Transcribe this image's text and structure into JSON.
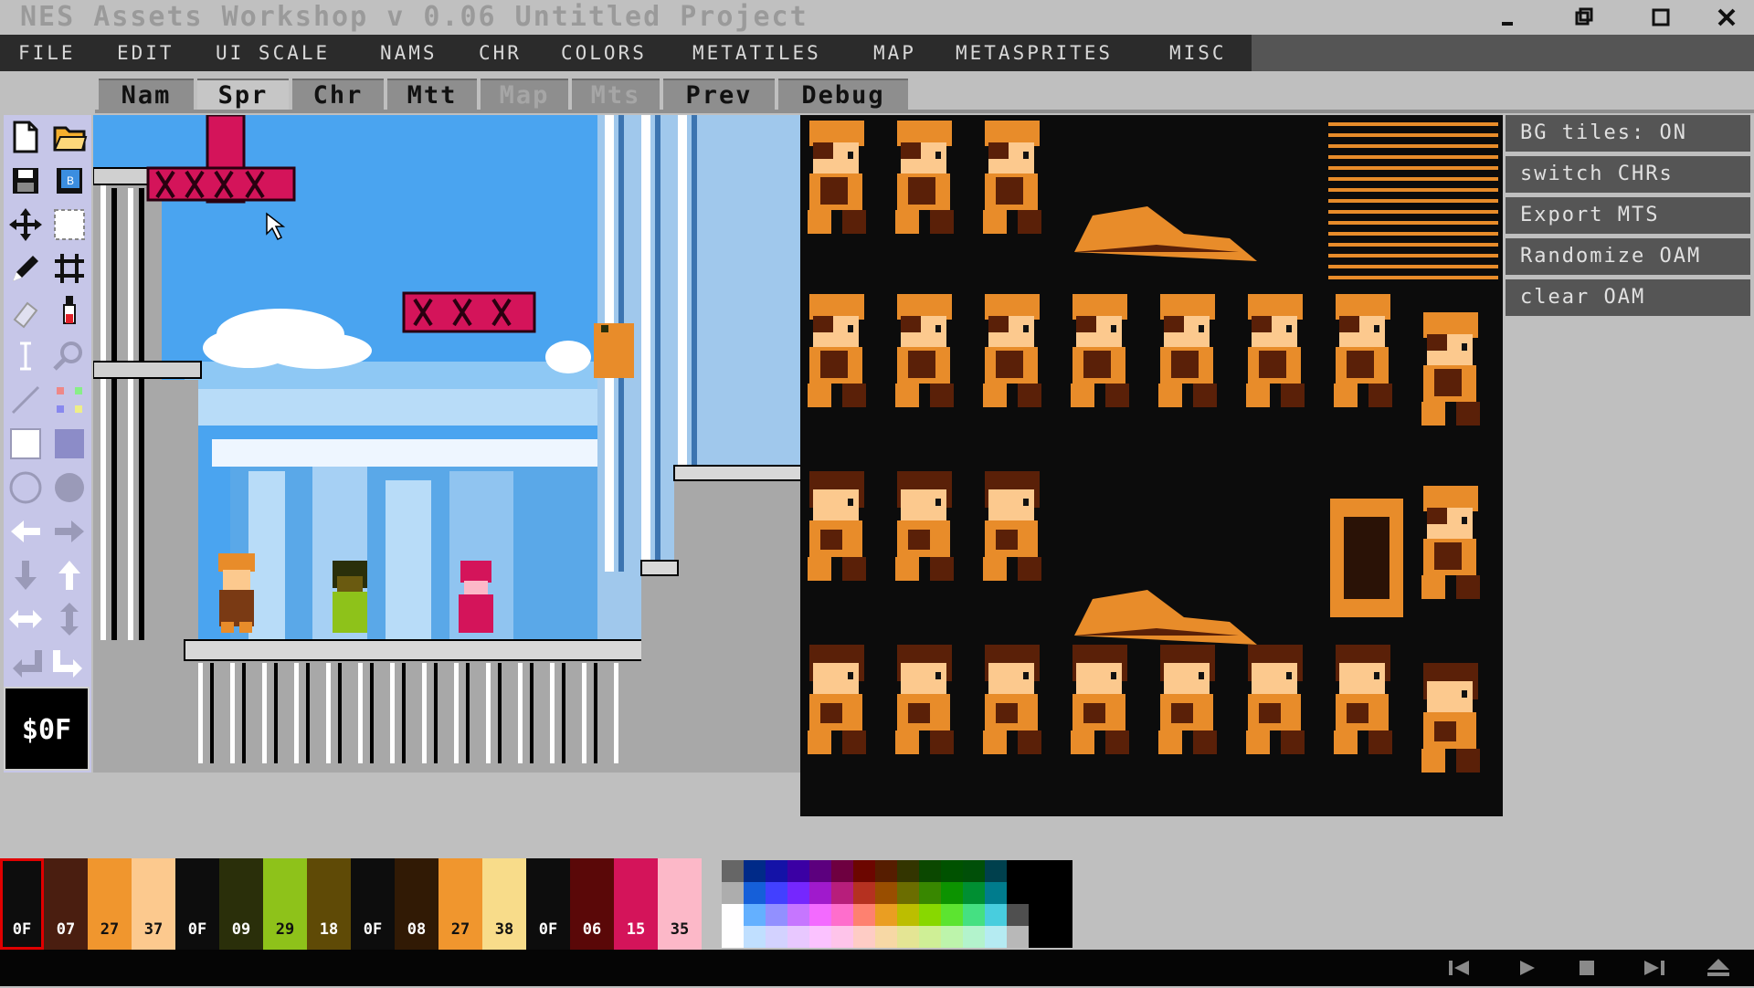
{
  "window": {
    "title": "NES Assets Workshop v 0.06 Untitled Project",
    "controls": [
      "minimize",
      "restore",
      "maximize",
      "close"
    ]
  },
  "menu": {
    "items": [
      "FILE",
      "EDIT",
      "UI SCALE",
      "NAMS",
      "CHR",
      "COLORS",
      "METATILES",
      "MAP",
      "METASPRITES",
      "MISC"
    ]
  },
  "tabs": {
    "items": [
      {
        "label": "Nam",
        "state": "normal"
      },
      {
        "label": "Spr",
        "state": "active"
      },
      {
        "label": "Chr",
        "state": "normal"
      },
      {
        "label": "Mtt",
        "state": "normal"
      },
      {
        "label": "Map",
        "state": "disabled"
      },
      {
        "label": "Mts",
        "state": "disabled"
      },
      {
        "label": "Prev",
        "state": "normal"
      },
      {
        "label": "Debug",
        "state": "normal"
      }
    ]
  },
  "tools": {
    "items": [
      "new-file",
      "open-folder",
      "save",
      "save-as",
      "move",
      "select",
      "pencil",
      "grid",
      "eraser",
      "eyedropper",
      "text",
      "zoom",
      "line",
      "pattern",
      "rect-outline",
      "rect-filled",
      "ellipse-outline",
      "ellipse-filled",
      "shift-left",
      "shift-right",
      "shift-down",
      "shift-up",
      "flip-horizontal",
      "flip-vertical",
      "rotate-left",
      "rotate-right"
    ],
    "current_color": "$0F"
  },
  "side_buttons": {
    "bg_tiles": "BG tiles: ON",
    "switch_chrs": "switch CHRs",
    "export_mts": "Export MTS",
    "randomize_oam": "Randomize OAM",
    "clear_oam": "clear OAM"
  },
  "palettes": {
    "swatches": [
      {
        "code": "0F",
        "color": "#0d0d0d",
        "text": "#ffffff"
      },
      {
        "code": "07",
        "color": "#4a1e10",
        "text": "#ffffff"
      },
      {
        "code": "27",
        "color": "#f0962e",
        "text": "#111111"
      },
      {
        "code": "37",
        "color": "#fcc98e",
        "text": "#111111"
      },
      {
        "code": "0F",
        "color": "#0d0d0d",
        "text": "#ffffff"
      },
      {
        "code": "09",
        "color": "#2a2f0a",
        "text": "#ffffff"
      },
      {
        "code": "29",
        "color": "#8ec21a",
        "text": "#111111"
      },
      {
        "code": "18",
        "color": "#5f4a06",
        "text": "#ffffff"
      },
      {
        "code": "0F",
        "color": "#0d0d0d",
        "text": "#ffffff"
      },
      {
        "code": "08",
        "color": "#311a05",
        "text": "#ffffff"
      },
      {
        "code": "27",
        "color": "#f0962e",
        "text": "#111111"
      },
      {
        "code": "38",
        "color": "#f8dc8a",
        "text": "#111111"
      },
      {
        "code": "0F",
        "color": "#0d0d0d",
        "text": "#ffffff"
      },
      {
        "code": "06",
        "color": "#5a0808",
        "text": "#ffffff"
      },
      {
        "code": "15",
        "color": "#d4145a",
        "text": "#ffffff"
      },
      {
        "code": "35",
        "color": "#fcb8c8",
        "text": "#111111"
      }
    ],
    "nes_master_palette": [
      [
        "#666666",
        "#002a88",
        "#1412a7",
        "#3b00a4",
        "#5c007e",
        "#6e0040",
        "#6c0600",
        "#561d00",
        "#333500",
        "#0b4800",
        "#005200",
        "#004f08",
        "#00404d",
        "#000000",
        "#000000",
        "#000000"
      ],
      [
        "#adadad",
        "#155fd9",
        "#4240ff",
        "#7527fe",
        "#a01acc",
        "#b71e7b",
        "#b53120",
        "#994e00",
        "#6b6d00",
        "#388700",
        "#0c9300",
        "#008f32",
        "#007c8d",
        "#000000",
        "#000000",
        "#000000"
      ],
      [
        "#fffeff",
        "#64b0ff",
        "#9290ff",
        "#c676ff",
        "#f36aff",
        "#fe6ecc",
        "#fe8170",
        "#ea9e22",
        "#bcbe00",
        "#88d800",
        "#5ce430",
        "#45e082",
        "#48cdde",
        "#4f4f4f",
        "#000000",
        "#000000"
      ],
      [
        "#fffeff",
        "#c0dfff",
        "#d3d2ff",
        "#e8c8ff",
        "#fbc2ff",
        "#fec4ea",
        "#feccc5",
        "#f7d8a5",
        "#e4e594",
        "#cfef96",
        "#bdf4ab",
        "#b3f3cc",
        "#b5ebf2",
        "#b8b8b8",
        "#000000",
        "#000000"
      ]
    ]
  },
  "transport": {
    "buttons": [
      "skip-back",
      "play",
      "stop",
      "skip-forward",
      "eject"
    ]
  }
}
